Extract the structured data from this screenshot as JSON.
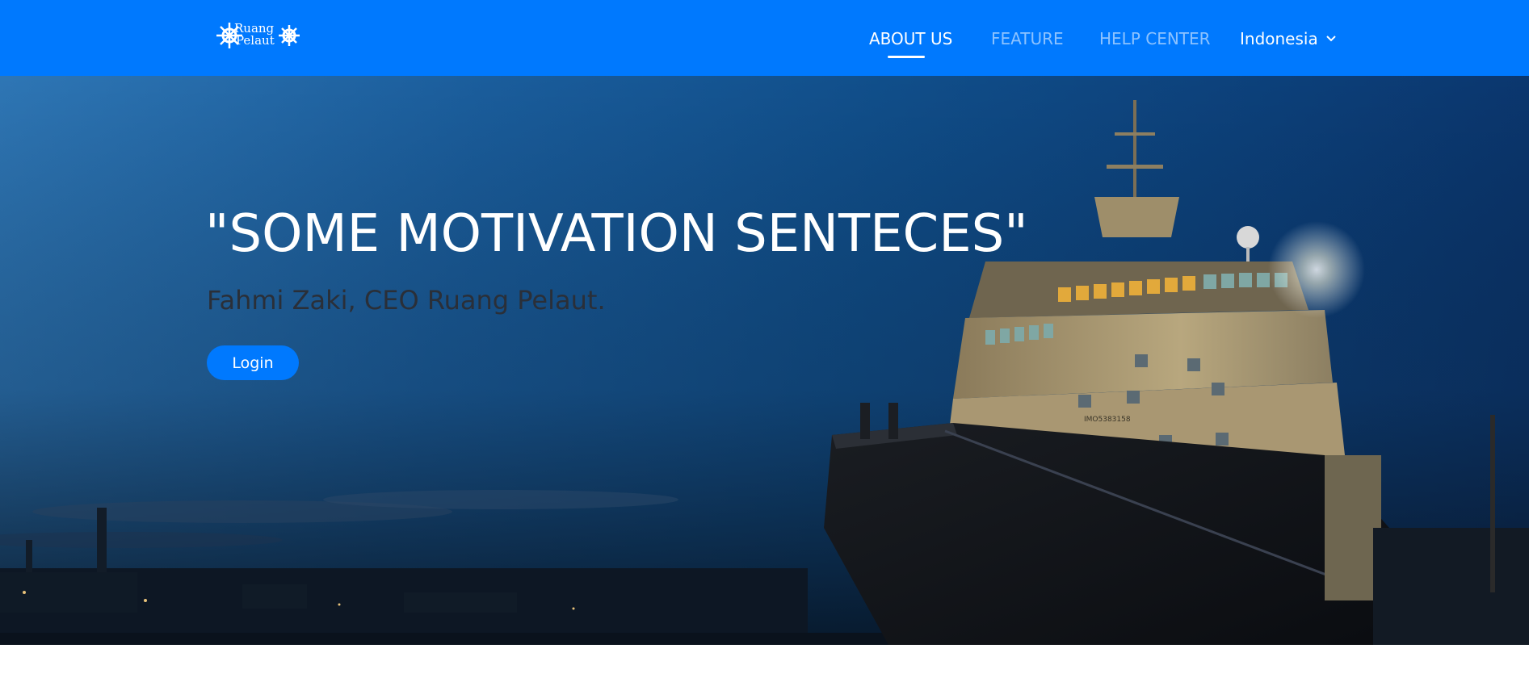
{
  "logo": {
    "line1": "Ruang",
    "line2": "Pelaut"
  },
  "nav": {
    "about_us": "ABOUT US",
    "feature": "FEATURE",
    "help_center": "HELP CENTER",
    "language": "Indonesia",
    "language_icon": "chevron-down-icon"
  },
  "hero": {
    "quote": "\"SOME MOTIVATION SENTECES\"",
    "author": "Fahmi Zaki, CEO Ruang Pelaut.",
    "login_label": "Login",
    "ship_marking": "IMO5383158"
  },
  "colors": {
    "primary": "#0079fe",
    "author_text": "#2a2f38"
  }
}
